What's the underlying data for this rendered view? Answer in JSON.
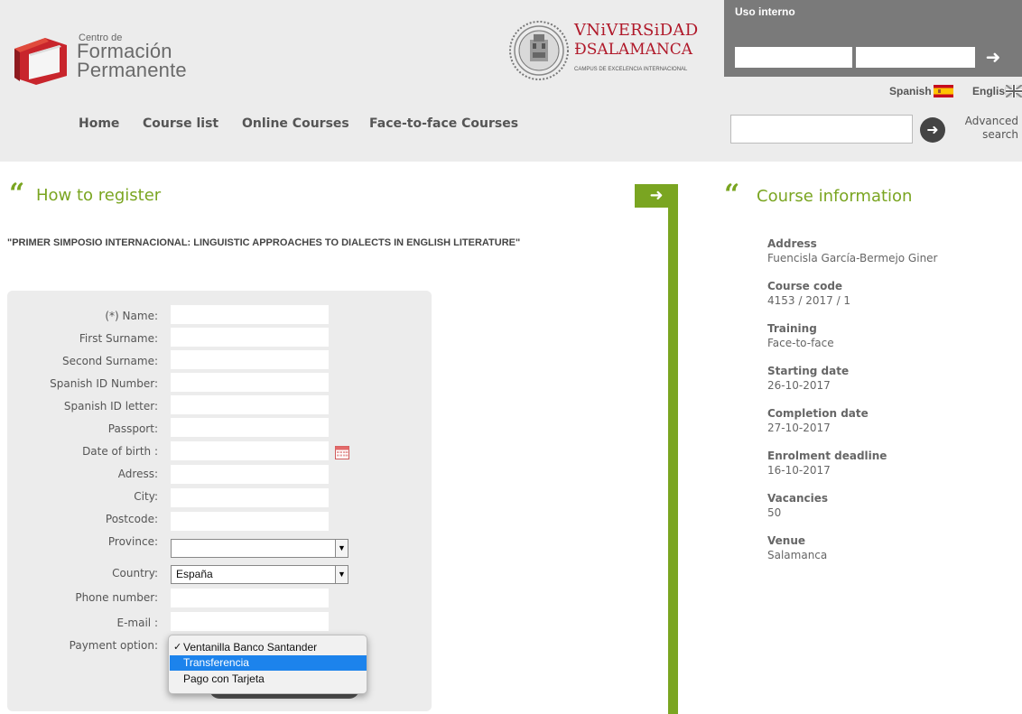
{
  "header": {
    "cfp_logo": {
      "line1": "Centro de",
      "line2": "Formación",
      "line3": "Permanente"
    },
    "usal_logo": {
      "line1": "VNiVERSiDAD",
      "line2": "ÐSALAMANCA",
      "line3": "CAMPUS DE EXCELENCIA INTERNACIONAL"
    },
    "uso_interno": {
      "label": "Uso interno",
      "field1_value": "",
      "field2_value": ""
    },
    "languages": {
      "spanish": "Spanish",
      "english": "English"
    },
    "nav": {
      "home": "Home",
      "course_list": "Course list",
      "online": "Online Courses",
      "face": "Face-to-face Courses"
    },
    "search": {
      "value": "",
      "advanced_line1": "Advanced",
      "advanced_line2": "search"
    }
  },
  "registration": {
    "heading": "How to register",
    "course_title": "\"PRIMER SIMPOSIO INTERNACIONAL: LINGUISTIC APPROACHES TO DIALECTS IN ENGLISH LITERATURE\"",
    "fields": {
      "name": "(*) Name:",
      "first_surname": "First Surname:",
      "second_surname": "Second Surname:",
      "id_number": "Spanish ID Number:",
      "id_letter": "Spanish ID letter:",
      "passport": "Passport:",
      "dob": "Date of birth :",
      "address": "Adress:",
      "city": "City:",
      "postcode": "Postcode:",
      "province": "Province:",
      "country": "Country:",
      "phone": "Phone number:",
      "email": "E-mail :",
      "payment": "Payment option:"
    },
    "province_value": "",
    "country_value": "España",
    "payment_options": [
      "Ventanilla Banco Santander",
      "Transferencia",
      "Pago con Tarjeta"
    ],
    "payment_selected": "Ventanilla Banco Santander",
    "payment_highlighted": "Transferencia"
  },
  "course_info": {
    "heading": "Course information",
    "items": [
      {
        "label": "Address",
        "value": "Fuencisla García-Bermejo Giner"
      },
      {
        "label": "Course code",
        "value": "4153 / 2017 / 1"
      },
      {
        "label": "Training",
        "value": "Face-to-face"
      },
      {
        "label": "Starting date",
        "value": "26-10-2017"
      },
      {
        "label": "Completion date",
        "value": "27-10-2017"
      },
      {
        "label": "Enrolment deadline",
        "value": "16-10-2017"
      },
      {
        "label": "Vacancies",
        "value": "50"
      },
      {
        "label": "Venue",
        "value": "Salamanca"
      }
    ]
  },
  "colors": {
    "accent_green": "#7aa521",
    "usal_red": "#b0192a",
    "select_blue": "#1c83ec",
    "header_gray": "#ececec"
  }
}
